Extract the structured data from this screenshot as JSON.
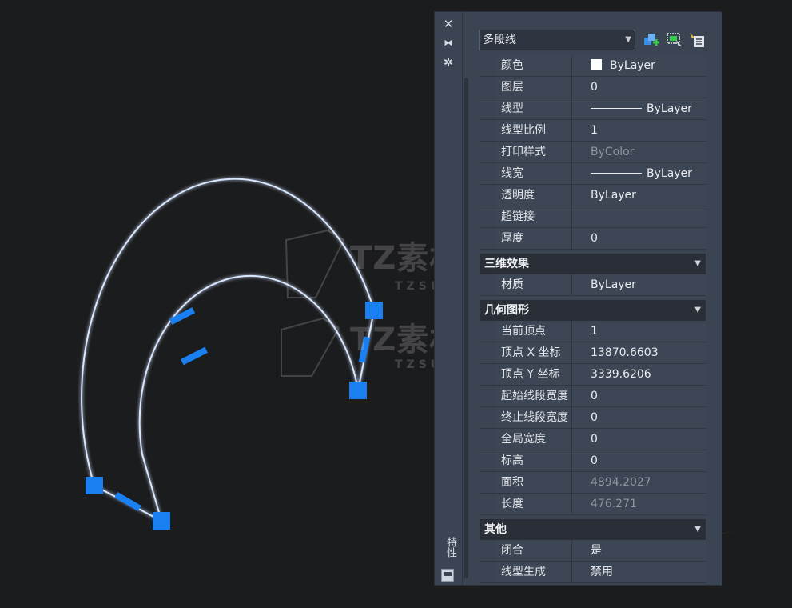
{
  "watermark": {
    "text_big": "TZ素材网",
    "text_small": "TZSUCAI.COM"
  },
  "panel": {
    "selector": {
      "value": "多段线"
    },
    "strip_title": "特性",
    "icons": [
      "quick-select-add-icon",
      "select-objects-icon",
      "toggle-pickadd-icon"
    ],
    "general": [
      {
        "label": "颜色",
        "value": "ByLayer",
        "swatch": "#ffffff"
      },
      {
        "label": "图层",
        "value": "0"
      },
      {
        "label": "线型",
        "value": "ByLayer",
        "line": true
      },
      {
        "label": "线型比例",
        "value": "1"
      },
      {
        "label": "打印样式",
        "value": "ByColor",
        "dim": true
      },
      {
        "label": "线宽",
        "value": "ByLayer",
        "line": true
      },
      {
        "label": "透明度",
        "value": "ByLayer"
      },
      {
        "label": "超链接",
        "value": ""
      },
      {
        "label": "厚度",
        "value": "0"
      }
    ],
    "sections": [
      {
        "title": "三维效果",
        "rows": [
          {
            "label": "材质",
            "value": "ByLayer"
          }
        ]
      },
      {
        "title": "几何图形",
        "rows": [
          {
            "label": "当前顶点",
            "value": "1"
          },
          {
            "label": "顶点 X 坐标",
            "value": "13870.6603"
          },
          {
            "label": "顶点 Y 坐标",
            "value": "3339.6206"
          },
          {
            "label": "起始线段宽度",
            "value": "0"
          },
          {
            "label": "终止线段宽度",
            "value": "0"
          },
          {
            "label": "全局宽度",
            "value": "0"
          },
          {
            "label": "标高",
            "value": "0"
          },
          {
            "label": "面积",
            "value": "4894.2027",
            "dim": true
          },
          {
            "label": "长度",
            "value": "476.271",
            "dim": true
          }
        ]
      },
      {
        "title": "其他",
        "rows": [
          {
            "label": "闭合",
            "value": "是"
          },
          {
            "label": "线型生成",
            "value": "禁用"
          }
        ]
      }
    ]
  },
  "colors": {
    "grip": "#1a7ff0",
    "arrow": "#e8444a",
    "polyline": "#cfe0ff"
  }
}
